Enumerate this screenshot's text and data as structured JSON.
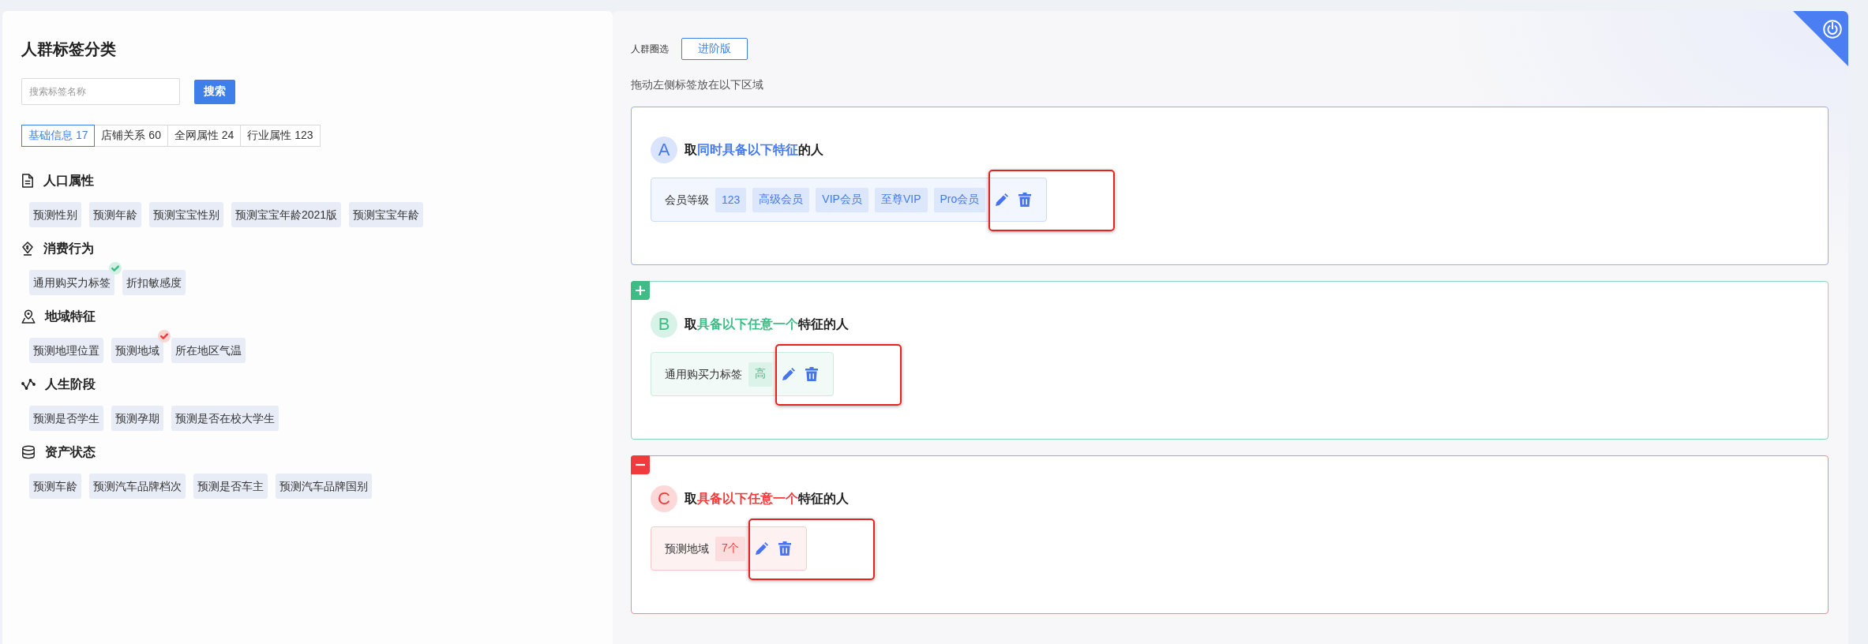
{
  "left_panel": {
    "title": "人群标签分类",
    "search": {
      "placeholder": "搜索标签名称",
      "button": "搜索"
    },
    "tabs": [
      {
        "label": "基础信息 17",
        "selected": true
      },
      {
        "label": "店铺关系 60",
        "selected": false
      },
      {
        "label": "全网属性 24",
        "selected": false
      },
      {
        "label": "行业属性 123",
        "selected": false
      }
    ],
    "sections": [
      {
        "title": "人口属性",
        "tags": [
          {
            "label": "预测性别",
            "checked": false
          },
          {
            "label": "预测年龄",
            "checked": false
          },
          {
            "label": "预测宝宝性别",
            "checked": false
          },
          {
            "label": "预测宝宝年龄2021版",
            "checked": false
          },
          {
            "label": "预测宝宝年龄",
            "checked": false
          }
        ]
      },
      {
        "title": "消费行为",
        "tags": [
          {
            "label": "通用购买力标签",
            "checked": true,
            "color": "#3dbd85"
          },
          {
            "label": "折扣敏感度",
            "checked": false
          }
        ]
      },
      {
        "title": "地域特征",
        "tags": [
          {
            "label": "预测地理位置",
            "checked": false
          },
          {
            "label": "预测地域",
            "checked": true,
            "color": "#ef3b3b"
          },
          {
            "label": "所在地区气温",
            "checked": false
          }
        ]
      },
      {
        "title": "人生阶段",
        "tags": [
          {
            "label": "预测是否学生",
            "checked": false
          },
          {
            "label": "预测孕期",
            "checked": false
          },
          {
            "label": "预测是否在校大学生",
            "checked": false
          }
        ]
      },
      {
        "title": "资产状态",
        "tags": [
          {
            "label": "预测车龄",
            "checked": false
          },
          {
            "label": "预测汽车品牌档次",
            "checked": false
          },
          {
            "label": "预测是否车主",
            "checked": false
          },
          {
            "label": "预测汽车品牌国别",
            "checked": false
          }
        ]
      }
    ]
  },
  "right_panel": {
    "mode_label": "人群圈选",
    "mode_button": "进阶版",
    "hint": "拖动左侧标签放在以下区域",
    "groups": [
      {
        "kind": "base",
        "letter": "A",
        "color": "#4479f0",
        "title": {
          "prefix": "取",
          "highlight": "同时具备以下特征",
          "suffix": "的人"
        },
        "conditions": [
          {
            "label": "会员等级",
            "values": [
              "123",
              "高级会员",
              "VIP会员",
              "至尊VIP",
              "Pro会员"
            ],
            "highlighted": true
          }
        ]
      },
      {
        "kind": "include",
        "letter": "B",
        "color": "#3dbd85",
        "title": {
          "prefix": "取",
          "highlight": "具备以下任意一个",
          "suffix": "特征的人"
        },
        "conditions": [
          {
            "label": "通用购买力标签",
            "values": [
              "高"
            ],
            "highlighted": true
          }
        ]
      },
      {
        "kind": "exclude",
        "letter": "C",
        "color": "#ef3b3b",
        "title": {
          "prefix": "取",
          "highlight": "具备以下任意一个",
          "suffix": "特征的人"
        },
        "conditions": [
          {
            "label": "预测地域",
            "values": [
              "7个"
            ],
            "highlighted": true
          }
        ]
      }
    ]
  }
}
